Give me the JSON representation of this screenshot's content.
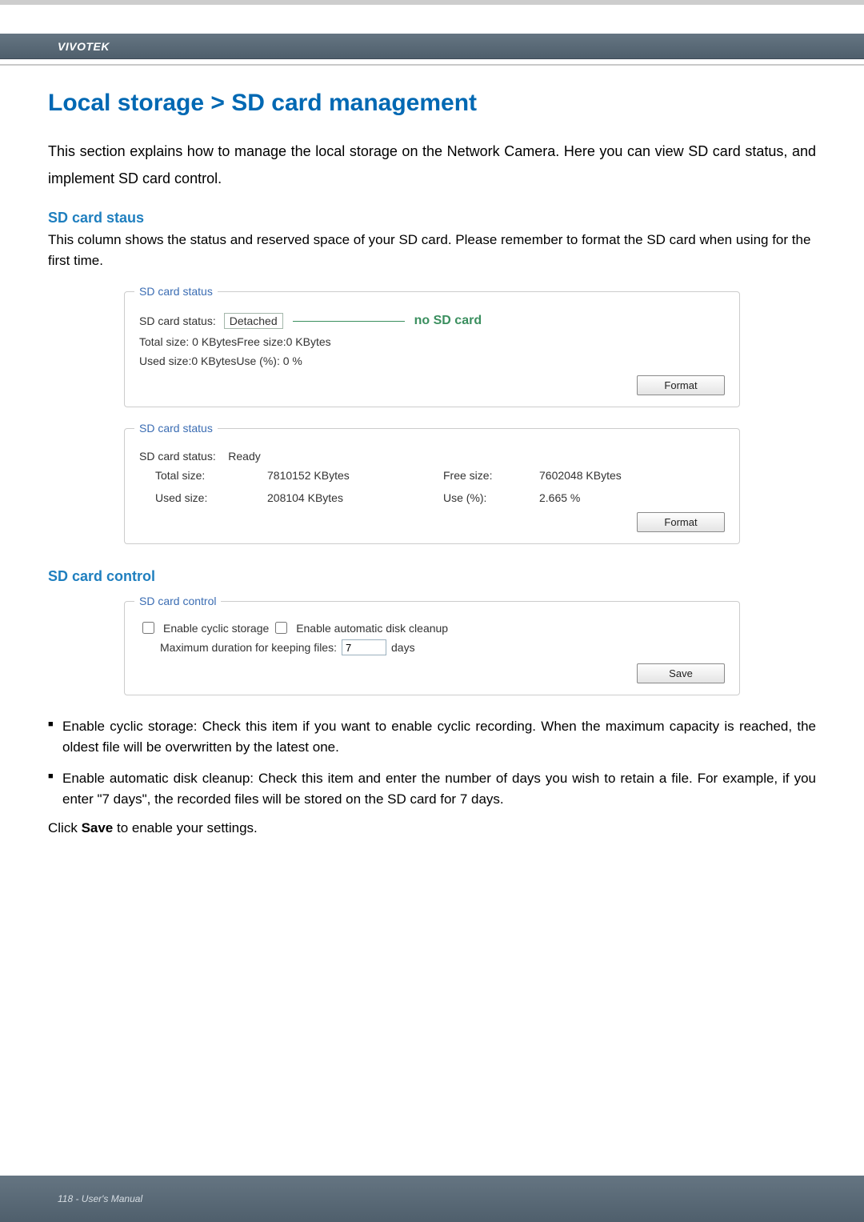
{
  "brand": "VIVOTEK",
  "page_title": "Local storage > SD card management",
  "intro": "This section explains how to manage the local storage on the Network Camera. Here you can view SD card status, and implement SD card control.",
  "status_section": {
    "heading": "SD card staus",
    "explain": "This column shows the status and reserved space of your SD card. Please remember to format the SD card when using for the first time."
  },
  "panel1": {
    "legend": "SD card status",
    "status_label": "SD card status:",
    "status_value": "Detached",
    "callout": "no SD card",
    "sizes_line": "Total size: 0  KBytesFree size:0  KBytes",
    "used_line": "Used size:0  KBytesUse (%):  0 %",
    "format_btn": "Format"
  },
  "panel2": {
    "legend": "SD card status",
    "status_label": "SD card status:",
    "status_value": "Ready",
    "total_label": "Total size:",
    "total_value": "7810152  KBytes",
    "free_label": "Free size:",
    "free_value": "7602048  KBytes",
    "used_label": "Used size:",
    "used_value": "208104  KBytes",
    "pct_label": "Use (%):",
    "pct_value": "2.665 %",
    "format_btn": "Format"
  },
  "control_section": {
    "heading": "SD card control"
  },
  "panel3": {
    "legend": "SD card control",
    "chk1": "Enable cyclic storage",
    "chk2": "Enable automatic disk cleanup",
    "max_label": "Maximum duration for keeping files:",
    "max_value": "7",
    "max_unit": "days",
    "save_btn": "Save"
  },
  "bullets": {
    "b1": "Enable cyclic storage: Check this item if you want to enable cyclic recording. When the maximum capacity is reached, the oldest file will be overwritten by the latest one.",
    "b2": "Enable automatic disk cleanup: Check this item and enter the number of days you wish to retain a file. For example, if you enter \"7 days\", the recorded files will be stored on the SD card for 7 days."
  },
  "closing_pre": "Click ",
  "closing_bold": "Save",
  "closing_post": " to enable your settings.",
  "footer": "118 - User's Manual"
}
